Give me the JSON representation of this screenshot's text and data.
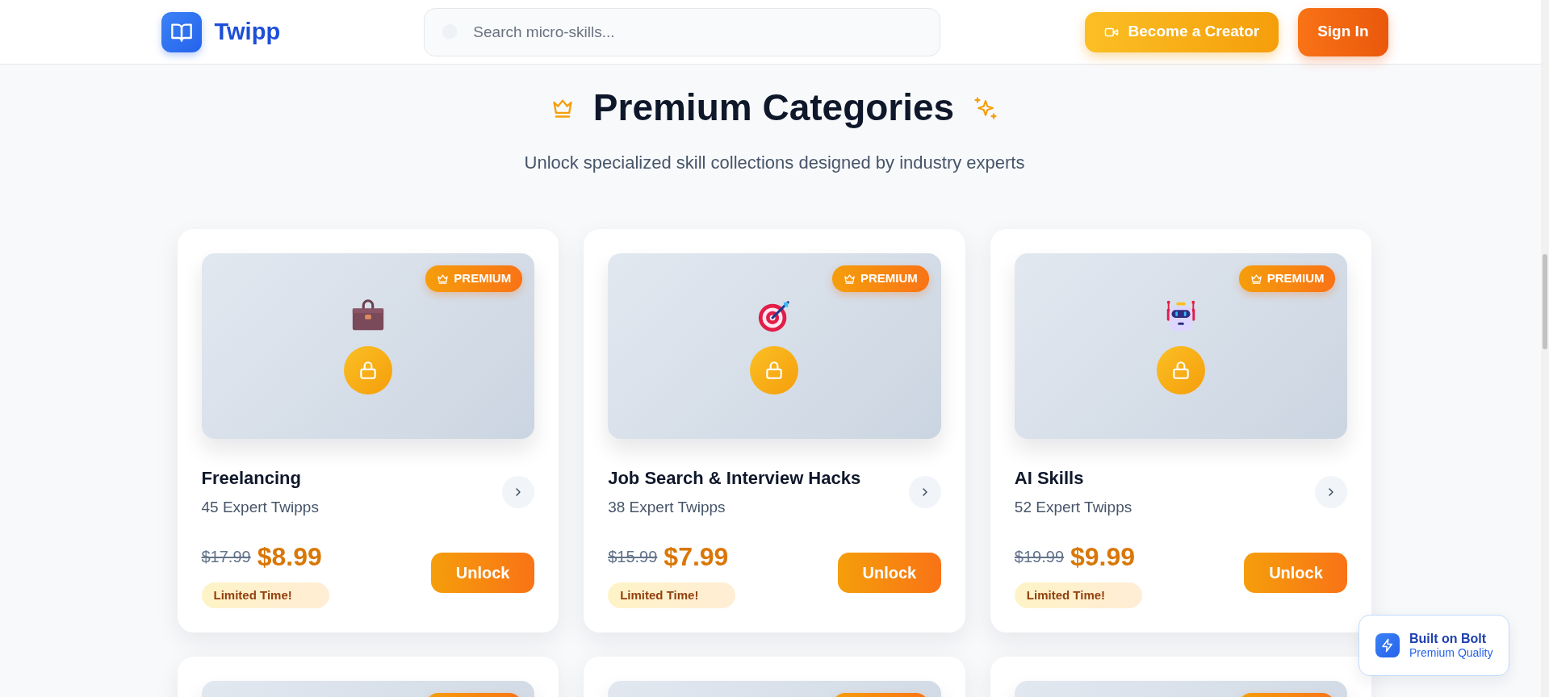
{
  "header": {
    "logo": "Twipp",
    "search": {
      "placeholder": "Search micro-skills..."
    },
    "buttons": [
      {
        "label": "Become a Creator",
        "kind": "creator"
      },
      {
        "label": "Sign In",
        "kind": "signin"
      }
    ]
  },
  "section": {
    "title": "Premium Categories",
    "subtitle": "Unlock specialized skill collections designed by industry experts"
  },
  "cards": [
    {
      "kind": "full",
      "badge": "PREMIUM",
      "title": "Freelancing",
      "count": "45 Expert Twipps",
      "old_price": "$17.99",
      "price": "$8.99",
      "tag": "Limited Time!",
      "button": "Unlock"
    },
    {
      "kind": "full",
      "badge": "PREMIUM",
      "title": "Job Search & Interview Hacks",
      "count": "38 Expert Twipps",
      "old_price": "$15.99",
      "price": "$7.99",
      "tag": "Limited Time!",
      "button": "Unlock"
    },
    {
      "kind": "full",
      "badge": "PREMIUM",
      "title": "AI Skills",
      "count": "52 Expert Twipps",
      "old_price": "$19.99",
      "price": "$9.99",
      "tag": "Limited Time!",
      "button": "Unlock"
    },
    {
      "kind": "partial"
    },
    {
      "kind": "partial"
    },
    {
      "kind": "partial"
    }
  ],
  "bolt_badge": {
    "title": "Built on Bolt",
    "subtitle": "Premium Quality"
  }
}
